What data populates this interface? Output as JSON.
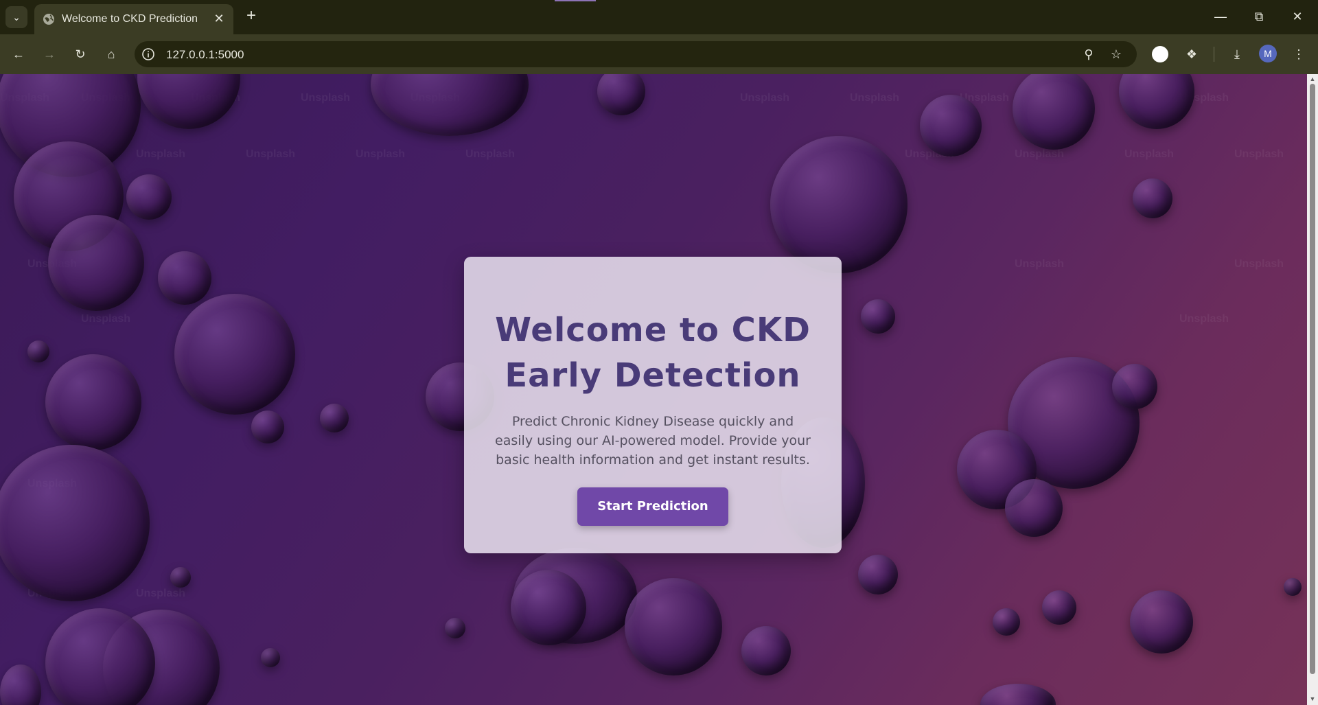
{
  "browser": {
    "tab_title": "Welcome to CKD Prediction",
    "url": "127.0.0.1:5000",
    "avatar_letter": "M",
    "icons": {
      "tab_search": "chevron-down-icon",
      "tab_close": "close-icon",
      "new_tab": "plus-icon",
      "minimize": "minimize-icon",
      "restore": "restore-icon",
      "close_window": "close-icon",
      "back": "back-arrow-icon",
      "forward": "forward-arrow-icon",
      "reload": "reload-icon",
      "home": "home-icon",
      "site_info": "info-icon",
      "zoom": "zoom-out-icon",
      "bookmark": "star-icon",
      "extensions": "puzzle-icon",
      "downloads": "download-icon",
      "menu": "more-vertical-icon"
    }
  },
  "page": {
    "watermark": "Unsplash",
    "card": {
      "title": "Welcome to CKD Early Detection",
      "description": "Predict Chronic Kidney Disease quickly and easily using our AI-powered model. Provide your basic health information and get instant results.",
      "button_label": "Start Prediction"
    },
    "colors": {
      "title": "#493b78",
      "button": "#7048a8",
      "background_start": "#3b1a56",
      "background_end": "#763258"
    }
  }
}
